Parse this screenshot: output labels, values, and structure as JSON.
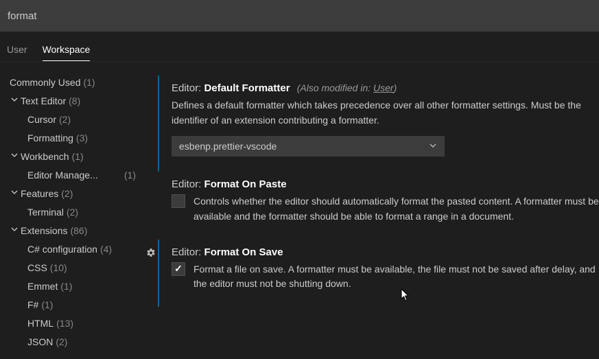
{
  "search": {
    "value": "format"
  },
  "tabs": {
    "user": "User",
    "workspace": "Workspace",
    "active": "workspace"
  },
  "sidebar": {
    "items": [
      {
        "label": "Commonly Used",
        "count": "(1)",
        "expandable": false,
        "level": 1,
        "noChevron": true
      },
      {
        "label": "Text Editor",
        "count": "(8)",
        "expandable": true,
        "level": 1
      },
      {
        "label": "Cursor",
        "count": "(2)",
        "expandable": false,
        "level": 2
      },
      {
        "label": "Formatting",
        "count": "(3)",
        "expandable": false,
        "level": 2
      },
      {
        "label": "Workbench",
        "count": "(1)",
        "expandable": true,
        "level": 1
      },
      {
        "label": "Editor Manage...",
        "count": "",
        "rightCount": "(1)",
        "expandable": false,
        "level": 2
      },
      {
        "label": "Features",
        "count": "(2)",
        "expandable": true,
        "level": 1
      },
      {
        "label": "Terminal",
        "count": "(2)",
        "expandable": false,
        "level": 2
      },
      {
        "label": "Extensions",
        "count": "(86)",
        "expandable": true,
        "level": 1
      },
      {
        "label": "C# configuration",
        "count": "(4)",
        "expandable": false,
        "level": 2
      },
      {
        "label": "CSS",
        "count": "(10)",
        "expandable": false,
        "level": 2
      },
      {
        "label": "Emmet",
        "count": "(1)",
        "expandable": false,
        "level": 2
      },
      {
        "label": "F#",
        "count": "(1)",
        "expandable": false,
        "level": 2
      },
      {
        "label": "HTML",
        "count": "(13)",
        "expandable": false,
        "level": 2
      },
      {
        "label": "JSON",
        "count": "(2)",
        "expandable": false,
        "level": 2
      }
    ]
  },
  "settings": {
    "defaultFormatter": {
      "prefix": "Editor:",
      "title": "Default Formatter",
      "also_prefix": "(Also modified in: ",
      "also_link": "User",
      "also_suffix": ")",
      "desc": "Defines a default formatter which takes precedence over all other formatter settings. Must be the identifier of an extension contributing a formatter.",
      "value": "esbenp.prettier-vscode"
    },
    "formatOnPaste": {
      "prefix": "Editor:",
      "title": "Format On Paste",
      "checked": false,
      "desc": "Controls whether the editor should automatically format the pasted content. A formatter must be available and the formatter should be able to format a range in a document."
    },
    "formatOnSave": {
      "prefix": "Editor:",
      "title": "Format On Save",
      "checked": true,
      "desc": "Format a file on save. A formatter must be available, the file must not be saved after delay, and the editor must not be shutting down."
    }
  }
}
